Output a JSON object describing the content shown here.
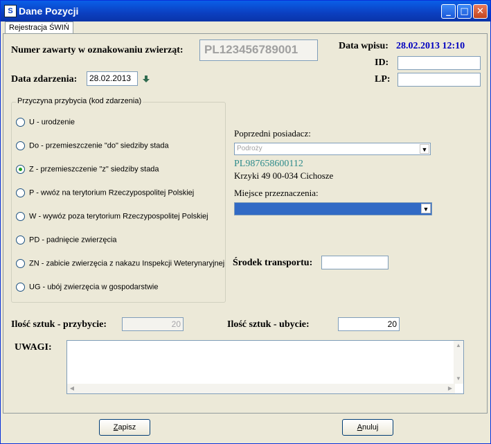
{
  "window": {
    "title": "Dane Pozycji",
    "app_icon": "S"
  },
  "tabs": [
    {
      "label": "Rejestracja ŚWIŃ"
    }
  ],
  "header": {
    "numer_label": "Numer zawarty w oznakowaniu zwierząt:",
    "numer_value": "PL123456789001",
    "data_wpisu_label": "Data wpisu:",
    "data_wpisu_value": "28.02.2013 12:10",
    "id_label": "ID:",
    "id_value": "",
    "lp_label": "LP:",
    "lp_value": "",
    "data_zdarzenia_label": "Data zdarzenia:",
    "data_zdarzenia_value": "28.02.2013"
  },
  "przyczyna": {
    "title": "Przyczyna przybycia (kod zdarzenia)",
    "selected_index": 2,
    "options": [
      "U - urodzenie",
      "Do - przemieszczenie \"do\" siedziby stada",
      "Z - przemieszczenie \"z\" siedziby stada",
      "P - wwóz na terytorium Rzeczypospolitej Polskiej",
      "W - wywóz poza terytorium Rzeczypospolitej Polskiej",
      "PD - padnięcie zwierzęcia",
      "ZN - zabicie zwierzęcia z nakazu Inspekcji Weterynaryjnej",
      "UG - ubój zwierzęcia w gospodarstwie"
    ]
  },
  "poprzedni": {
    "label": "Poprzedni posiadacz:",
    "combo_value": "Podroży",
    "number": "PL987658600112",
    "address": "Krzyki 49 00-034 Cichosze",
    "number_color": "#2e8b8b"
  },
  "miejsce": {
    "label": "Miejsce przeznaczenia:",
    "value": ""
  },
  "transport": {
    "label": "Środek transportu:",
    "value": ""
  },
  "ilosc": {
    "przybycie_label": "Ilość sztuk - przybycie:",
    "przybycie_value": "20",
    "ubycie_label": "Ilość sztuk - ubycie:",
    "ubycie_value": "20"
  },
  "uwagi": {
    "label": "UWAGI:",
    "value": ""
  },
  "buttons": {
    "save_first": "Z",
    "save_rest": "apisz",
    "cancel_first": "A",
    "cancel_rest": "nuluj"
  },
  "colors": {
    "title_bar": "#0b3fc0",
    "accent_blue": "#0000c0",
    "selection": "#316ac5"
  }
}
